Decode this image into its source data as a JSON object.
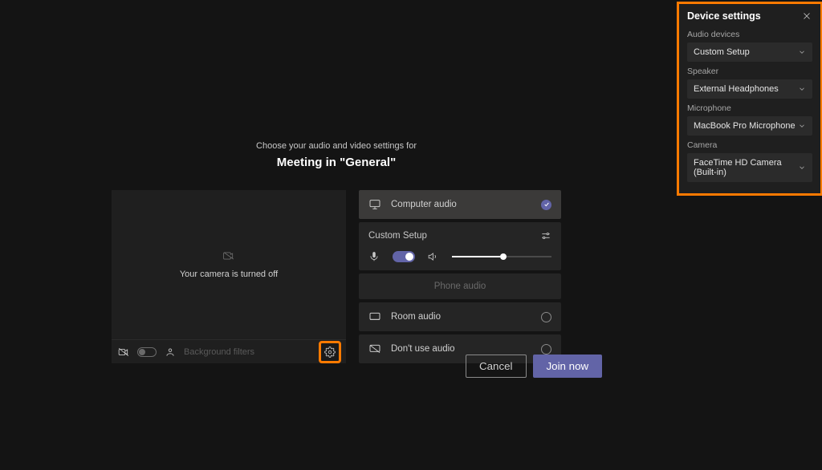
{
  "prejoin": {
    "subtitle": "Choose your audio and video settings for",
    "title": "Meeting in \"General\"",
    "camera_off_text": "Your camera is turned off",
    "bg_filters_label": "Background filters"
  },
  "audio_options": {
    "computer_audio": "Computer audio",
    "custom_setup": "Custom Setup",
    "phone_audio": "Phone audio",
    "room_audio": "Room audio",
    "dont_use_audio": "Don't use audio"
  },
  "buttons": {
    "cancel": "Cancel",
    "join": "Join now"
  },
  "device_panel": {
    "title": "Device settings",
    "audio_devices_label": "Audio devices",
    "audio_devices_value": "Custom Setup",
    "speaker_label": "Speaker",
    "speaker_value": "External Headphones",
    "microphone_label": "Microphone",
    "microphone_value": "MacBook Pro Microphone",
    "camera_label": "Camera",
    "camera_value": "FaceTime HD Camera (Built-in)"
  }
}
